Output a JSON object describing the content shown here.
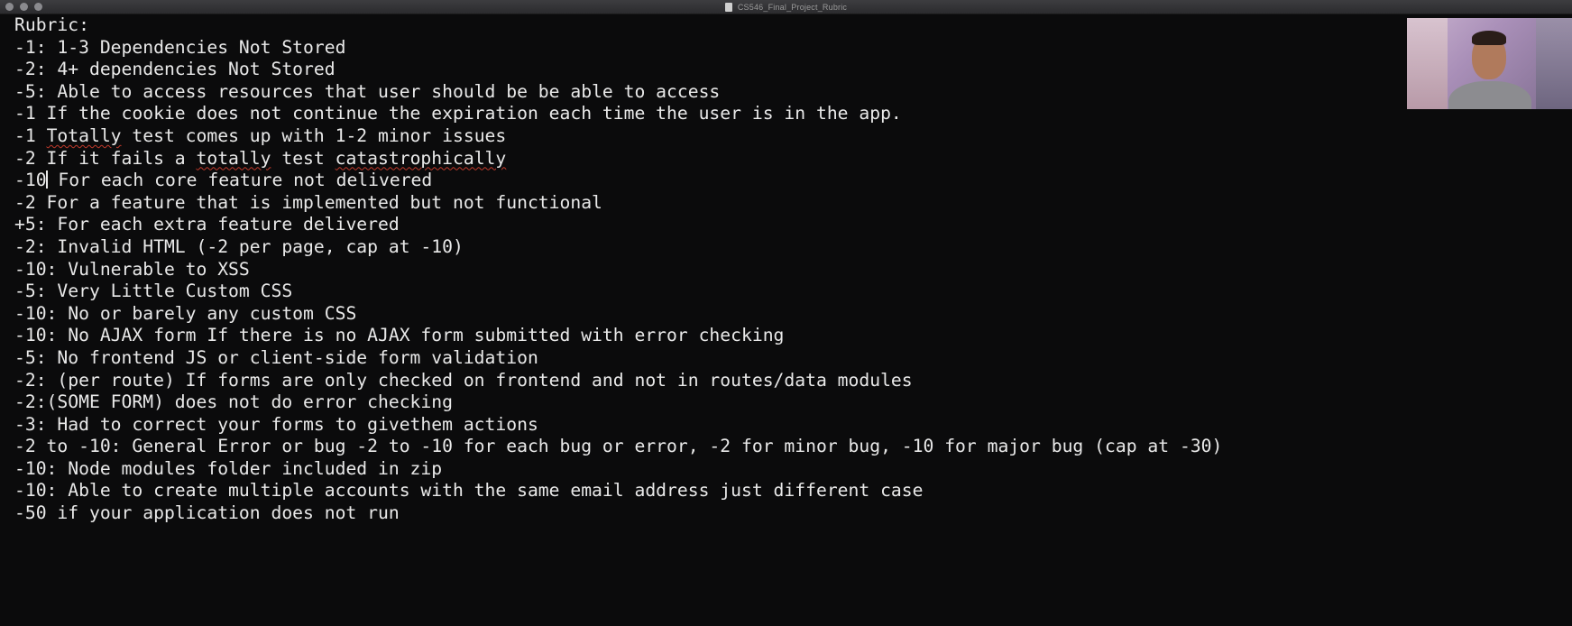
{
  "window": {
    "title": "CS546_Final_Project_Rubric"
  },
  "document": {
    "lines": [
      {
        "text": "Rubric:"
      },
      {
        "text": "-1: 1-3 Dependencies Not Stored"
      },
      {
        "text": "-2: 4+ dependencies Not Stored"
      },
      {
        "text": "-5: Able to access resources that user should be be able to access"
      },
      {
        "text": "-1 If the cookie does not continue the expiration each time the user is in the app."
      },
      {
        "pre": "-1 ",
        "err": "Totally",
        "post": " test comes up with 1-2 minor issues"
      },
      {
        "pre": "-2 If it fails a ",
        "err": "totally",
        "mid": " test ",
        "err2": "catastrophically"
      },
      {
        "pre": "-10",
        "caret": true,
        "post": " For each core feature not delivered"
      },
      {
        "text": "-2 For a feature that is implemented but not functional"
      },
      {
        "text": "+5: For each extra feature delivered"
      },
      {
        "text": "-2: Invalid HTML (-2 per page, cap at -10)"
      },
      {
        "text": "-10: Vulnerable to XSS"
      },
      {
        "text": "-5: Very Little Custom CSS"
      },
      {
        "text": "-10: No or barely any custom CSS"
      },
      {
        "text": "-10: No AJAX form If there is no AJAX form submitted with error checking"
      },
      {
        "text": "-5: No frontend JS or client-side form validation"
      },
      {
        "text": "-2: (per route) If forms are only checked on frontend and not in routes/data modules"
      },
      {
        "text": "-2:(SOME FORM) does not do error checking"
      },
      {
        "text": "-3: Had to correct your forms to givethem actions"
      },
      {
        "text": "-2 to -10: General Error or bug -2 to -10 for each bug or error, -2 for minor bug, -10 for major bug (cap at -30)"
      },
      {
        "text": "-10: Node modules folder included in zip"
      },
      {
        "text": "-10: Able to create multiple accounts with the same email address just different case"
      },
      {
        "text": "-50 if your application does not run"
      }
    ]
  },
  "colors": {
    "background": "#0b0b0c",
    "text": "#e9e9e9",
    "spellcheck_underline": "#c0392b"
  },
  "icons": {
    "title_icon": "document-icon",
    "traffic_lights": [
      "close-button-icon",
      "minimize-button-icon",
      "zoom-button-icon"
    ]
  }
}
